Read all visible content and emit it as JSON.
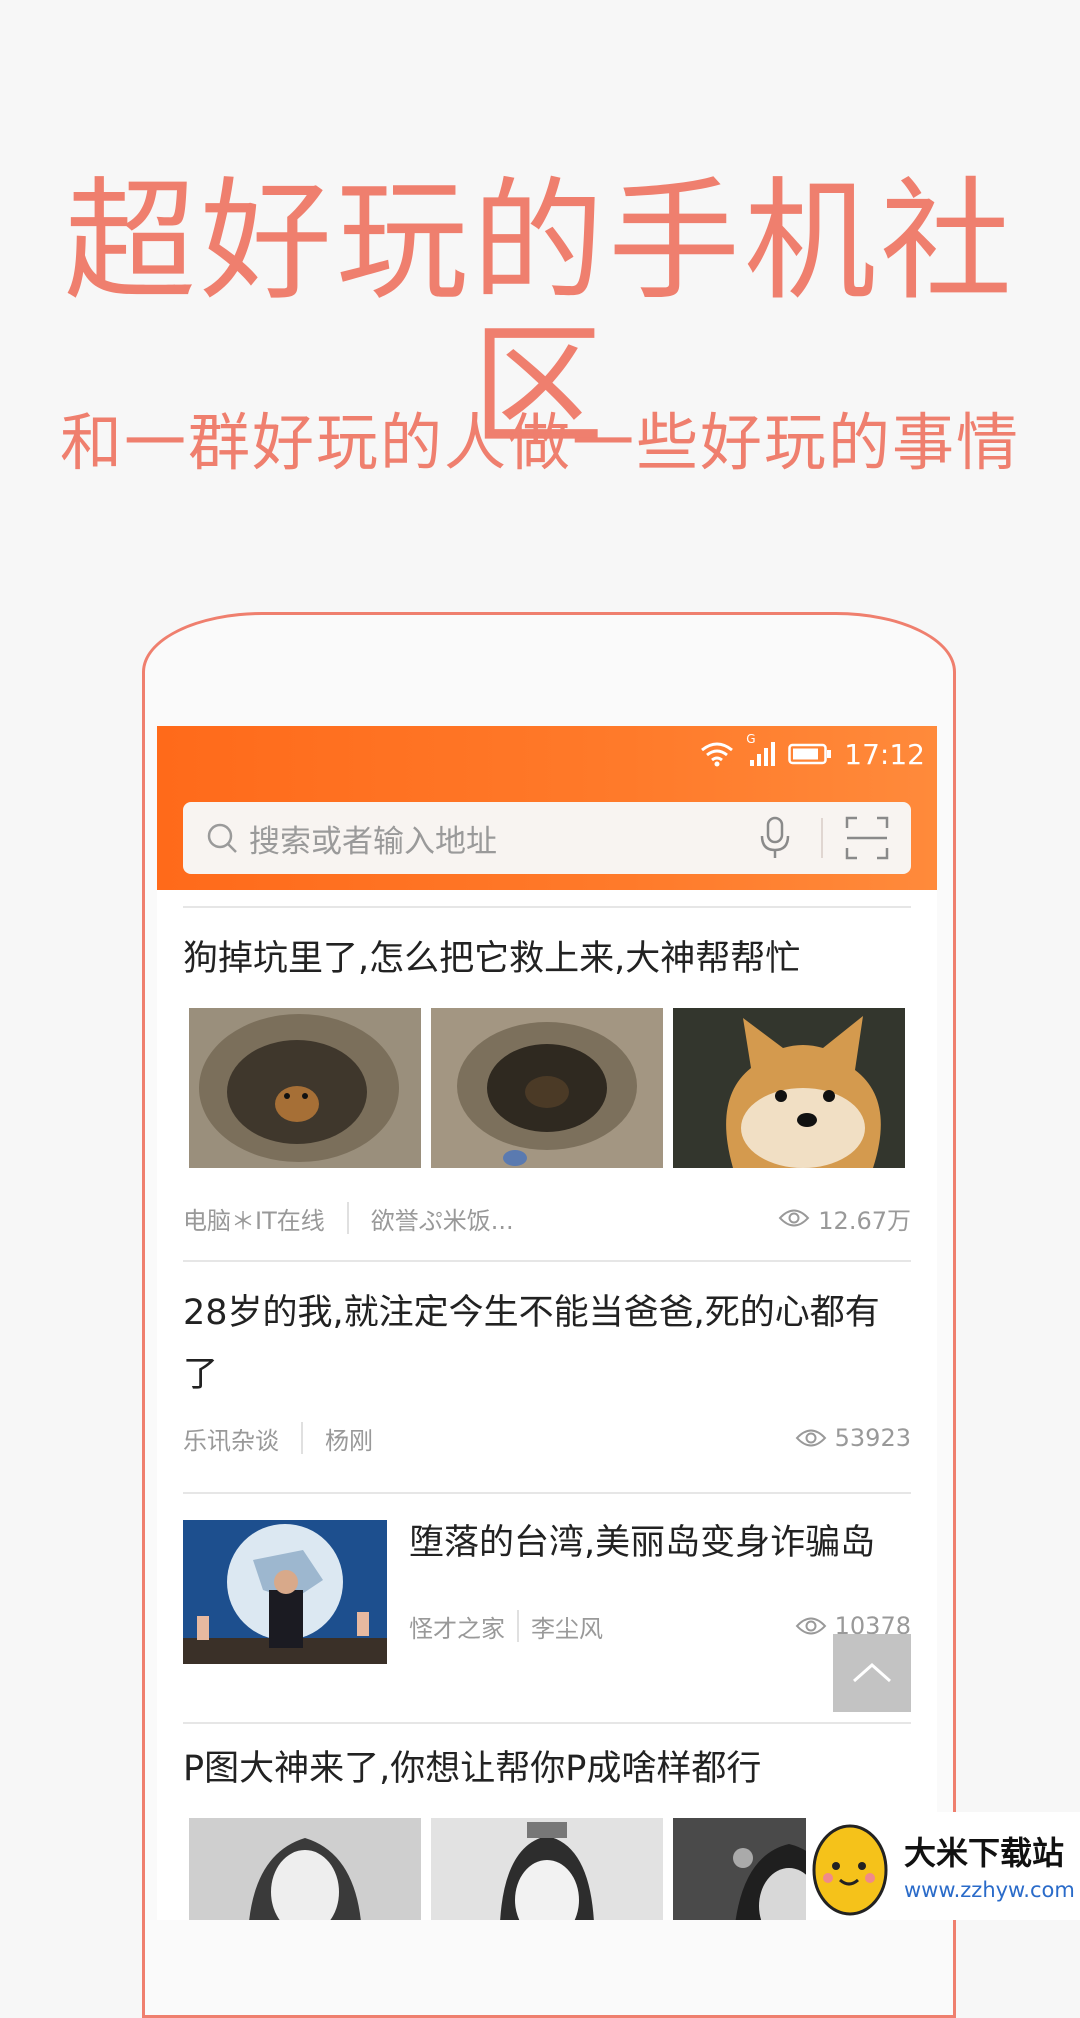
{
  "promo": {
    "headline": "超好玩的手机社区",
    "subline": "和一群好玩的人做一些好玩的事情"
  },
  "status_bar": {
    "network": "G",
    "time": "17:12"
  },
  "search": {
    "placeholder": "搜索或者输入地址"
  },
  "feed": [
    {
      "title": "狗掉坑里了,怎么把它救上来,大神帮帮忙",
      "source": "电脑＊IT在线",
      "author": "欲誉ぷ米饭...",
      "views": "12.67万"
    },
    {
      "title": "28岁的我,就注定今生不能当爸爸,死的心都有了",
      "source": "乐讯杂谈",
      "author": "杨刚",
      "views": "53923"
    },
    {
      "title": "堕落的台湾,美丽岛变身诈骗岛",
      "source": "怪才之家",
      "author": "李尘风",
      "views": "10378"
    },
    {
      "title": "P图大神来了,你想让帮你P成啥样都行"
    }
  ],
  "watermark": {
    "name": "大米下载站",
    "url": "www.zzhyw.com"
  },
  "colors": {
    "accent": "#ef7f6e",
    "topbar": "#ff6a1a"
  }
}
